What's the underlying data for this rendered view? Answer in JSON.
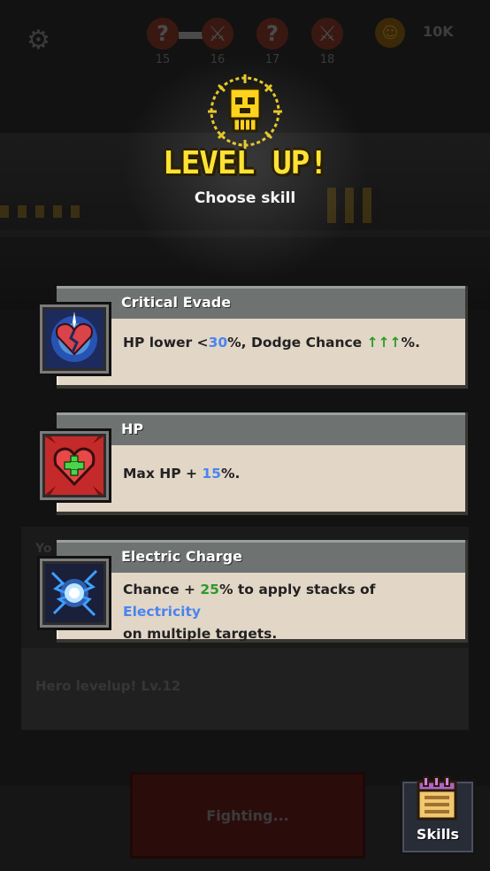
{
  "top_bar": {
    "stages": [
      {
        "number": "15",
        "icon": "question-mark-icon"
      },
      {
        "number": "16",
        "icon": "sword-icon"
      },
      {
        "number": "17",
        "icon": "question-mark-icon"
      },
      {
        "number": "18",
        "icon": "sword-icon"
      }
    ],
    "coins": "10K"
  },
  "level_up": {
    "title": "LEVEL UP!",
    "subtitle": "Choose skill"
  },
  "skills": [
    {
      "name": "Critical Evade",
      "icon": "broken-heart-icon",
      "desc_prefix": "HP lower <",
      "desc_value": "30",
      "desc_mid": "%, Dodge Chance ",
      "desc_arrows": "↑↑↑",
      "desc_suffix": "%."
    },
    {
      "name": "HP",
      "icon": "heart-plus-icon",
      "desc_prefix": "Max HP + ",
      "desc_value": "15",
      "desc_suffix": "%."
    },
    {
      "name": "Electric Charge",
      "icon": "electric-orb-icon",
      "desc_prefix": "Chance + ",
      "desc_value": "25",
      "desc_mid": "% to apply stacks of ",
      "desc_keyword": "Electricity",
      "desc_line2": "on multiple targets."
    }
  ],
  "background": {
    "log_partial": "Yo",
    "log_entry": "Hero levelup! Lv.12",
    "fight_button": "Fighting..."
  },
  "skills_button": {
    "label": "Skills"
  },
  "colors": {
    "title_yellow": "#ffe234",
    "value_blue": "#4a84f0",
    "arrow_green": "#2b9b2a",
    "card_body": "#e2d6c6",
    "card_header": "#6e7372"
  }
}
